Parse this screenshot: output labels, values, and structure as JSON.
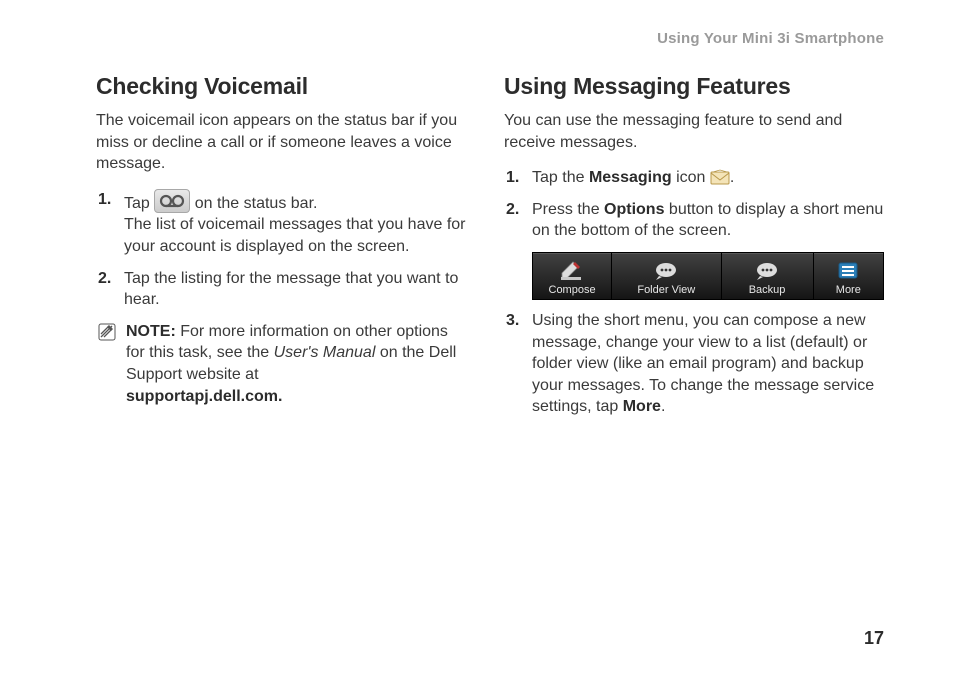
{
  "running_head": "Using Your Mini 3i Smartphone",
  "page_number": "17",
  "left": {
    "heading": "Checking Voicemail",
    "intro": "The voicemail icon appears on the status bar if you miss or decline a call or if someone leaves a voice message.",
    "step1_a": "Tap ",
    "step1_b": " on the status bar.",
    "step1_c": "The list of voicemail messages that you have for your account is displayed on the screen.",
    "step2": "Tap the listing for the message that you want to hear.",
    "note_label": "NOTE:",
    "note_a": " For more information on other options for this task, see the ",
    "note_manual": "User's Manual",
    "note_b": " on the Dell Support website at ",
    "note_url": "supportapj.dell.com."
  },
  "right": {
    "heading": "Using Messaging Features",
    "intro": "You can use the messaging feature to send and receive messages.",
    "step1_a": "Tap the ",
    "step1_bold": "Messaging",
    "step1_b": " icon ",
    "step1_c": ".",
    "step2_a": "Press the ",
    "step2_bold": "Options",
    "step2_b": " button to display a short menu on the bottom of the screen.",
    "menu": {
      "compose": "Compose",
      "folder_view": "Folder View",
      "backup": "Backup",
      "more": "More"
    },
    "step3_a": "Using the short menu, you can compose a new message, change your view to a list (default) or folder view (like an email program) and backup your messages. To change the message service settings, tap ",
    "step3_bold": "More",
    "step3_b": "."
  }
}
